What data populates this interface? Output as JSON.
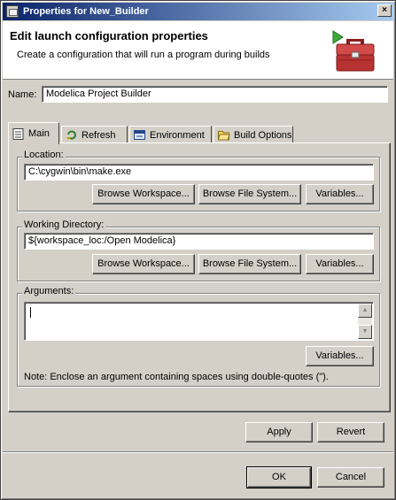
{
  "window": {
    "title": "Properties for New_Builder",
    "close_glyph": "×"
  },
  "header": {
    "title": "Edit launch configuration properties",
    "description": "Create a configuration that will run a program during builds",
    "icon": "toolbox-run-icon"
  },
  "name_field": {
    "label": "Name:",
    "value": "Modelica Project Builder"
  },
  "tabs": [
    {
      "label": "Main",
      "icon": "main-page-icon",
      "active": true
    },
    {
      "label": "Refresh",
      "icon": "refresh-icon",
      "active": false
    },
    {
      "label": "Environment",
      "icon": "environment-icon",
      "active": false
    },
    {
      "label": "Build Options",
      "icon": "folder-open-icon",
      "active": false
    }
  ],
  "location": {
    "legend": "Location:",
    "value": "C:\\cygwin\\bin\\make.exe",
    "buttons": [
      "Browse Workspace...",
      "Browse File System...",
      "Variables..."
    ]
  },
  "working_directory": {
    "legend": "Working Directory:",
    "value": "${workspace_loc:/Open Modelica}",
    "buttons": [
      "Browse Workspace...",
      "Browse File System...",
      "Variables..."
    ]
  },
  "arguments": {
    "legend": "Arguments:",
    "value": "",
    "variables_button": "Variables...",
    "note": "Note: Enclose an argument containing spaces using double-quotes (\")."
  },
  "bottom_buttons": {
    "apply": "Apply",
    "revert": "Revert",
    "ok": "OK",
    "cancel": "Cancel"
  }
}
